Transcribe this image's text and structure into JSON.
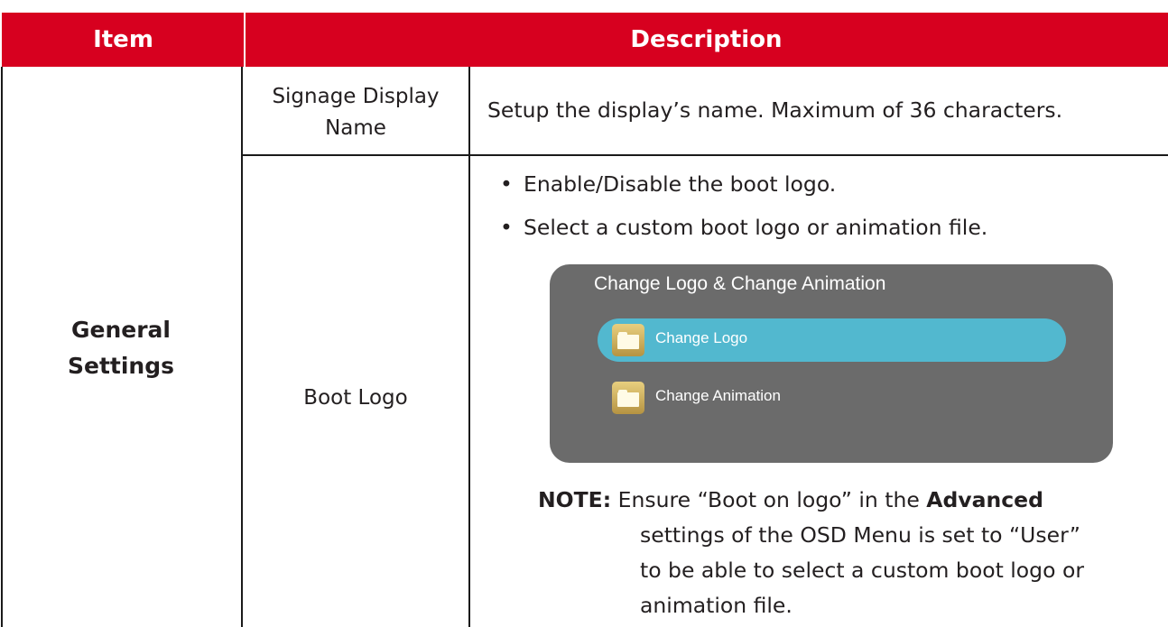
{
  "header": {
    "item": "Item",
    "description": "Description"
  },
  "rows": {
    "category": [
      "General",
      "Settings"
    ],
    "signage": {
      "label": [
        "Signage Display",
        "Name"
      ],
      "description": "Setup the display’s name. Maximum of 36 characters."
    },
    "boot_logo": {
      "label": "Boot Logo",
      "bullets": [
        "Enable/Disable the boot logo.",
        "Select a custom boot logo or animation file."
      ],
      "osd": {
        "title": "Change Logo & Change Animation",
        "options": [
          "Change Logo",
          "Change Animation"
        ],
        "selected": "Change Logo",
        "colors": {
          "panel": "#6b6b6b",
          "selected": "#52b8cf"
        }
      },
      "note": {
        "label": "NOTE:",
        "pre": "Ensure “Boot on logo” in the",
        "bold": "Advanced",
        "lines": [
          "settings of the OSD Menu is set to “User”",
          "to be able to select a custom boot logo or",
          "animation file."
        ]
      }
    }
  },
  "colors": {
    "header": "#d7001f"
  }
}
